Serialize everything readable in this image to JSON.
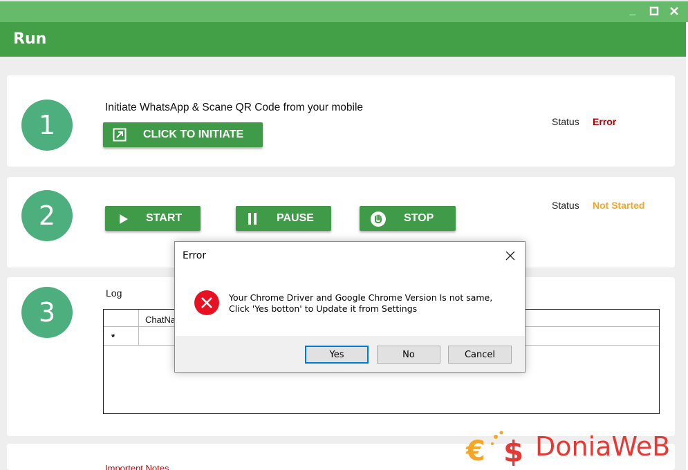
{
  "window": {
    "title": "Run",
    "controls": {
      "minimize": "_",
      "maximize": "☐",
      "close": "✕"
    }
  },
  "steps": [
    {
      "number": "1",
      "instruction": "Initiate WhatsApp & Scane QR Code from your mobile",
      "button_label": "CLICK TO INITIATE",
      "status_label": "Status",
      "status_value": "Error",
      "status_color": "#b00000"
    },
    {
      "number": "2",
      "buttons": {
        "start": "START",
        "pause": "PAUSE",
        "stop": "STOP"
      },
      "status_label": "Status",
      "status_value": "Not Started",
      "status_color": "#f5a623"
    },
    {
      "number": "3",
      "log_label": "Log",
      "grid": {
        "columns": [
          "ChatNa"
        ],
        "new_row_marker": "*"
      }
    }
  ],
  "notes_heading": "Importent Notes",
  "dialog": {
    "title": "Error",
    "message_line1": "Your Chrome Driver and Google Chrome Version Is not same,",
    "message_line2": "Click 'Yes botton' to Update it from Settings",
    "buttons": {
      "yes": "Yes",
      "no": "No",
      "cancel": "Cancel"
    }
  },
  "watermark": {
    "text": "DoniaWeB"
  },
  "colors": {
    "titlebar": "#66bb6a",
    "header": "#43a047",
    "button": "#3f9b47",
    "step_circle": "#4caf7d",
    "error_icon": "#e81123"
  }
}
